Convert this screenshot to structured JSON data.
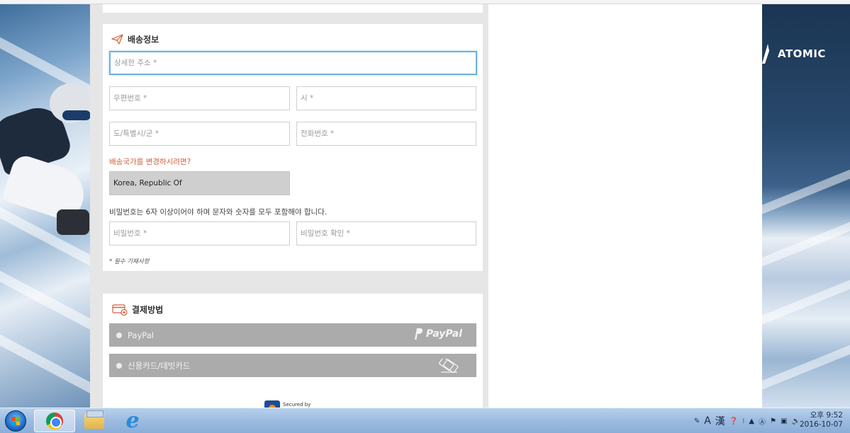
{
  "shipping": {
    "title": "배송정보",
    "address_placeholder": "상세한 주소 *",
    "postal_placeholder": "우편번호 *",
    "city_placeholder": "시 *",
    "province_placeholder": "도/특별시/군 *",
    "phone_placeholder": "전화번호 *",
    "change_country_link": "배송국가를 변경하시려면?",
    "country_value": "Korea, Republic Of",
    "password_note": "비밀번호는 6자 이상이어야 하며 문자와 숫자를 모두 포함해야 합니다.",
    "password_placeholder": "비밀번호 *",
    "password_confirm_placeholder": "비밀번호 확인 *",
    "required_note": "* 필수 기재사항"
  },
  "payment": {
    "title": "결제방법",
    "options": [
      {
        "label": "PayPal",
        "logo_text": "PayPal",
        "icon": "paypal-icon"
      },
      {
        "label": "신용카드/데빗카드",
        "icon": "credit-card-icon"
      }
    ],
    "secured_text": "Secured by"
  },
  "brand": {
    "name": "ATOMIC"
  },
  "taskbar": {
    "ime_char": "A",
    "ime_hanja": "漢",
    "clock_time": "오후 9:52",
    "clock_date": "2016-10-07"
  },
  "colors": {
    "accent_orange": "#d2603a",
    "focus_blue": "#6fb1de",
    "pay_option_bg": "#ababab"
  }
}
